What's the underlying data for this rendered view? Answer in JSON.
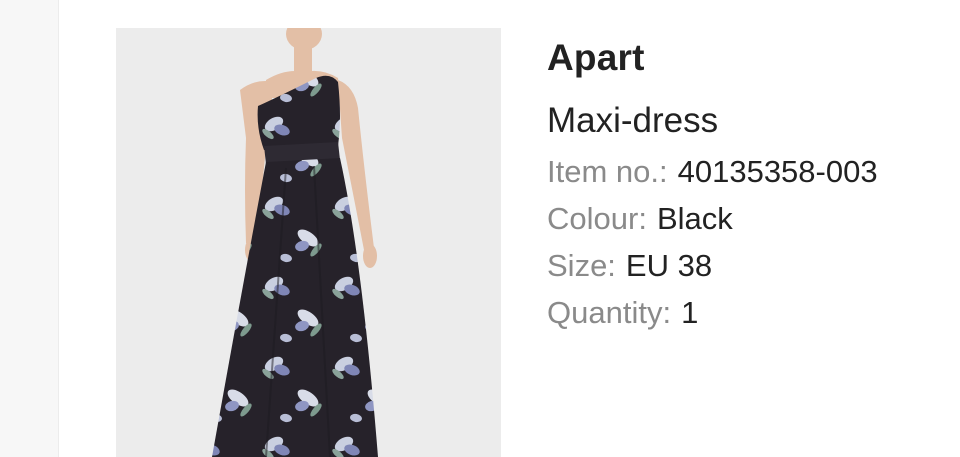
{
  "product": {
    "brand": "Apart",
    "name": "Maxi-dress",
    "image_alt": "Model wearing black floral one-shoulder maxi dress",
    "details": [
      {
        "label": "Item no.:",
        "value": "40135358-003"
      },
      {
        "label": "Colour:",
        "value": "Black"
      },
      {
        "label": "Size:",
        "value": "EU 38"
      },
      {
        "label": "Quantity:",
        "value": "1"
      }
    ]
  },
  "colors": {
    "dress": "#26222a",
    "flower_light": "#c9cfe0",
    "flower_blue": "#7f86b6",
    "leaf": "#8aa39a",
    "skin": "#e3bfa6"
  }
}
